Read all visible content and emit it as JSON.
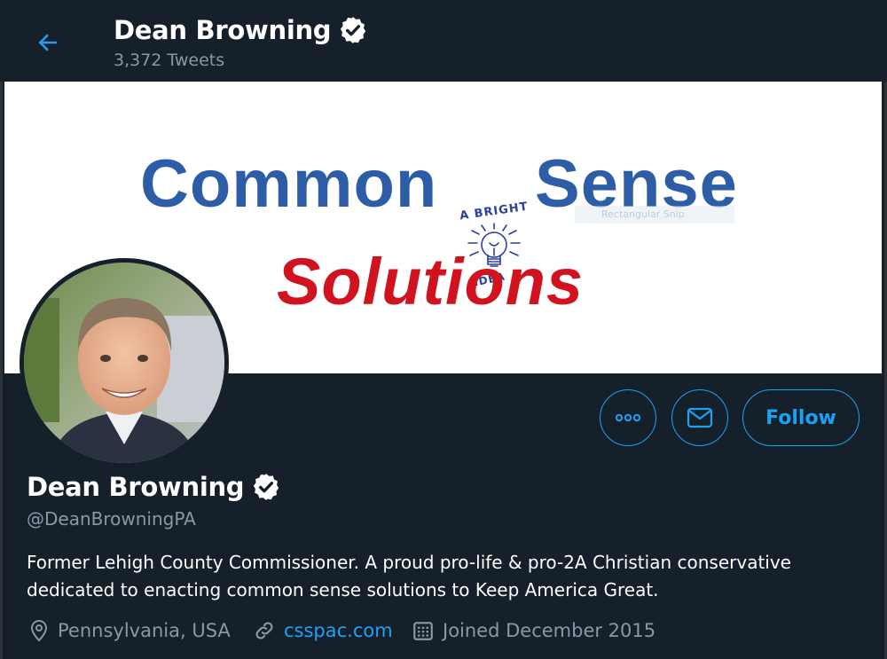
{
  "header": {
    "name": "Dean Browning",
    "tweet_count": "3,372 Tweets",
    "verified_icon": "verified-badge-icon",
    "back_icon": "arrow-left-icon"
  },
  "banner": {
    "word1": "Common",
    "word2": "Sense",
    "word3": "Solutions",
    "bulb_top_text": "A BRIGHT",
    "bulb_bottom_text": "IDEA",
    "snip_text": "Rectangular Snip",
    "colors": {
      "blue": "#2e5da8",
      "red": "#d1121f"
    }
  },
  "actions": {
    "more_icon": "more-horizontal-icon",
    "mail_icon": "mail-icon",
    "follow_label": "Follow"
  },
  "profile": {
    "name": "Dean Browning",
    "handle": "@DeanBrowningPA",
    "bio": "Former Lehigh County Commissioner. A proud pro-life & pro-2A Christian conservative dedicated to enacting common sense solutions to Keep America Great.",
    "location": "Pennsylvania, USA",
    "website": "csspac.com",
    "joined": "Joined December 2015"
  },
  "colors": {
    "background": "#15202b",
    "accent": "#1da1f2",
    "secondary_text": "#8899a6"
  }
}
